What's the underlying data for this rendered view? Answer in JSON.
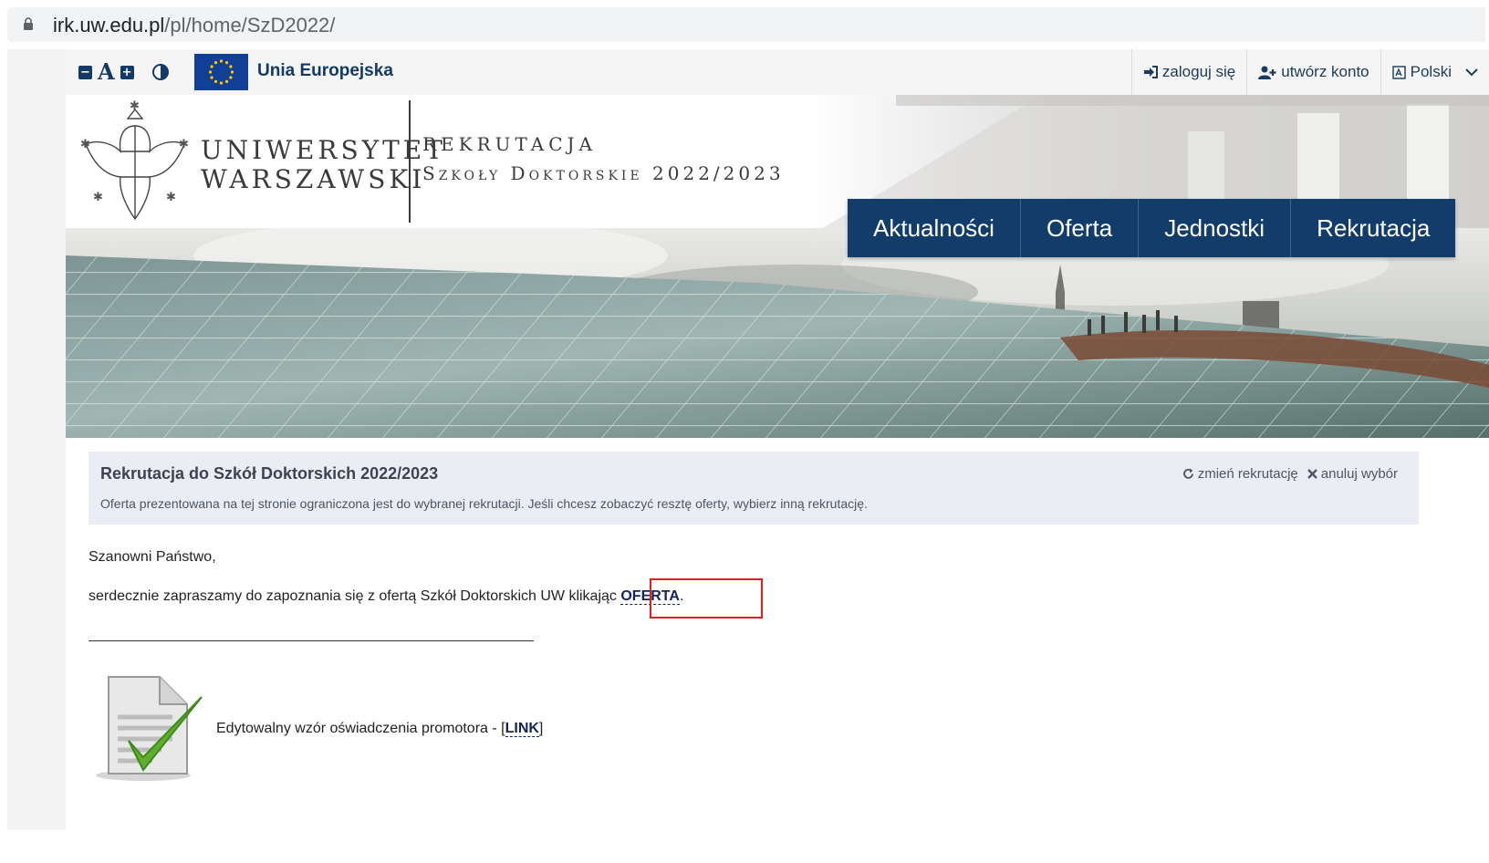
{
  "browser": {
    "url_domain": "irk.uw.edu.pl",
    "url_path": "/pl/home/SzD2022/"
  },
  "topbar": {
    "font_decrease": "−",
    "font_label": "A",
    "font_increase": "+",
    "eu_label": "Unia Europejska",
    "login_label": "zaloguj się",
    "register_label": "utwórz konto",
    "language_label": "Polski"
  },
  "header": {
    "university_line1": "UNIWERSYTET",
    "university_line2": "WARSZAWSKI",
    "title": "REKRUTACJA",
    "subtitle": "Szkoły Doktorskie 2022/2023"
  },
  "nav": {
    "items": [
      "Aktualności",
      "Oferta",
      "Jednostki",
      "Rekrutacja"
    ]
  },
  "panel": {
    "title": "Rekrutacja do Szkół Doktorskich 2022/2023",
    "description": "Oferta prezentowana na tej stronie ograniczona jest do wybranej rekrutacji. Jeśli chcesz zobaczyć resztę oferty, wybierz inną rekrutację.",
    "change_label": "zmień rekrutację",
    "cancel_label": "anuluj wybór"
  },
  "content": {
    "greeting": "Szanowni Państwo,",
    "invite_text": "serdecznie zapraszamy do zapoznania się z ofertą Szkół Doktorskich UW klikając ",
    "offer_link": "OFERTA",
    "invite_end": ".",
    "doc_text": "Edytowalny wzór oświadczenia promotora - ",
    "doc_link_open": "[",
    "doc_link": "LINK",
    "doc_link_close": "]"
  },
  "colors": {
    "navy": "#123d6a",
    "accent_blue": "#0e92d4",
    "highlight_red": "#e02020",
    "panel_bg": "#eaeef4"
  }
}
